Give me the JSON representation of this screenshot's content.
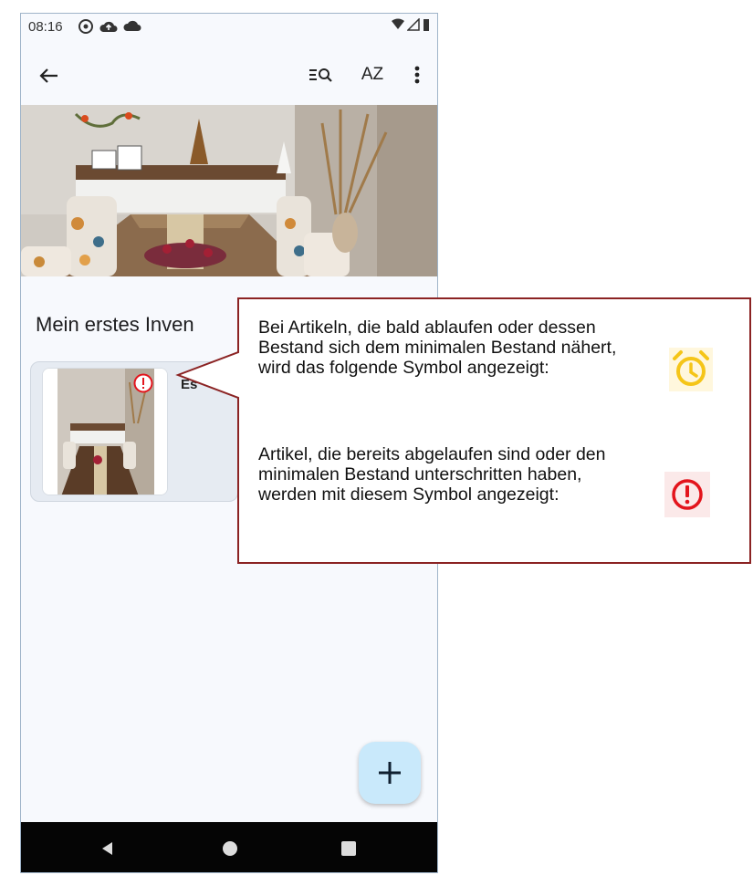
{
  "status_bar": {
    "time": "08:16"
  },
  "appbar": {
    "icons": [
      "back-arrow-icon",
      "search-list-icon",
      "sort-az-icon",
      "more-vert-icon"
    ],
    "sort_label": "AZ"
  },
  "inventory": {
    "title": "Mein erstes Inven",
    "card_label": "Es"
  },
  "tooltip": {
    "text_warning": "Bei Artikeln, die bald ablaufen oder dessen Bestand sich dem minimalen Bestand nähert, wird das folgende Symbol angezeigt:",
    "text_expired": "Artikel, die bereits abgelaufen sind oder den minimalen Bestand unterschritten haben, werden mit diesem Symbol angezeigt:",
    "warning_icon": "alarm-clock-icon",
    "expired_icon": "exclamation-circle-icon"
  },
  "colors": {
    "warning": "#f5c518",
    "expired": "#e3141c",
    "callout_border": "#8b2323",
    "fab": "#c9e9fb"
  },
  "fab": {
    "icon": "plus-icon"
  },
  "navbar": {
    "icons": [
      "nav-back-icon",
      "nav-home-icon",
      "nav-recents-icon"
    ]
  }
}
